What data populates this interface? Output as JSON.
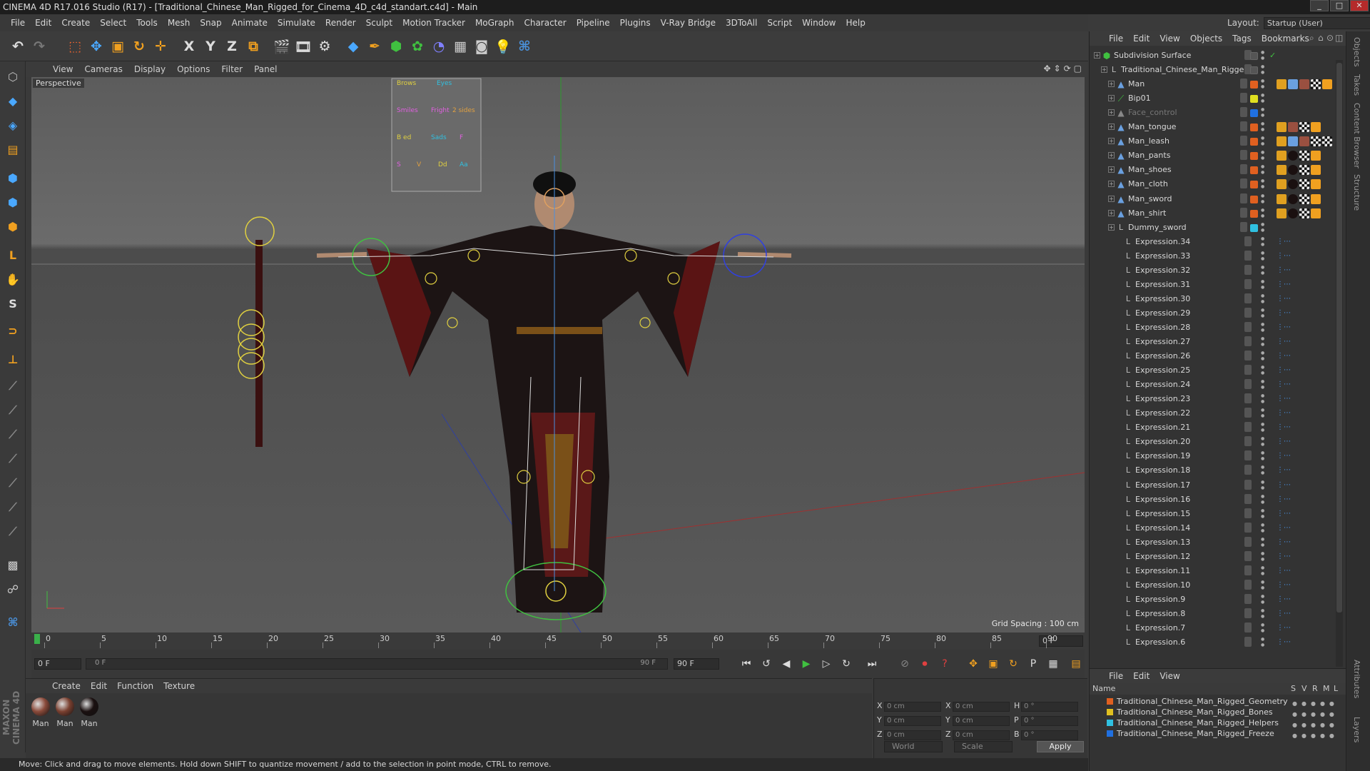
{
  "window": {
    "title": "CINEMA 4D R17.016 Studio (R17) - [Traditional_Chinese_Man_Rigged_for_Cinema_4D_c4d_standart.c4d] - Main",
    "controls": [
      "_",
      "□",
      "✕"
    ]
  },
  "menubar": {
    "items": [
      "File",
      "Edit",
      "Create",
      "Select",
      "Tools",
      "Mesh",
      "Snap",
      "Animate",
      "Simulate",
      "Render",
      "Sculpt",
      "Motion Tracker",
      "MoGraph",
      "Character",
      "Pipeline",
      "Plugins",
      "V-Ray Bridge",
      "3DToAll",
      "Script",
      "Window",
      "Help"
    ],
    "layout_label": "Layout:",
    "layout_value": "Startup (User)"
  },
  "toolbar": {
    "icons": [
      {
        "name": "undo-icon",
        "glyph": "↶",
        "color": "#dddddd"
      },
      {
        "name": "redo-icon",
        "glyph": "↷",
        "color": "#777777"
      },
      {
        "name": "live-selection-icon",
        "glyph": "⬚",
        "color": "#e06030"
      },
      {
        "name": "move-icon",
        "glyph": "✥",
        "color": "#4aa8ff"
      },
      {
        "name": "scale-icon",
        "glyph": "▣",
        "color": "#f0a020"
      },
      {
        "name": "rotate-icon",
        "glyph": "↻",
        "color": "#f0a020"
      },
      {
        "name": "transform-icon",
        "glyph": "✛",
        "color": "#f0a020"
      },
      {
        "name": "x-axis-icon",
        "glyph": "X",
        "color": "#dddddd"
      },
      {
        "name": "y-axis-icon",
        "glyph": "Y",
        "color": "#dddddd"
      },
      {
        "name": "z-axis-icon",
        "glyph": "Z",
        "color": "#dddddd"
      },
      {
        "name": "coordinate-system-icon",
        "glyph": "⧉",
        "color": "#f0a020"
      },
      {
        "name": "render-view-icon",
        "glyph": "🎬",
        "color": "#dddddd"
      },
      {
        "name": "render-picture-viewer-icon",
        "glyph": "🎞",
        "color": "#dddddd"
      },
      {
        "name": "render-settings-icon",
        "glyph": "⚙",
        "color": "#dddddd"
      },
      {
        "name": "cube-icon",
        "glyph": "◆",
        "color": "#4aa8ff"
      },
      {
        "name": "pen-icon",
        "glyph": "✒",
        "color": "#f0a020"
      },
      {
        "name": "subdivision-icon",
        "glyph": "⬢",
        "color": "#40c040"
      },
      {
        "name": "cloner-icon",
        "glyph": "✿",
        "color": "#40c040"
      },
      {
        "name": "deformer-icon",
        "glyph": "◔",
        "color": "#8080ff"
      },
      {
        "name": "floor-icon",
        "glyph": "▦",
        "color": "#cccccc"
      },
      {
        "name": "camera-icon",
        "glyph": "◙",
        "color": "#cccccc"
      },
      {
        "name": "light-icon",
        "glyph": "💡",
        "color": "#cccccc"
      },
      {
        "name": "python-icon",
        "glyph": "⌘",
        "color": "#4a90d9"
      }
    ]
  },
  "lefttools": [
    {
      "name": "make-editable-icon",
      "glyph": "⬡",
      "color": "#bbbbbb"
    },
    {
      "name": "model-mode-icon",
      "glyph": "◆",
      "color": "#4aa8ff"
    },
    {
      "name": "texture-mode-icon",
      "glyph": "◈",
      "color": "#4aa8ff"
    },
    {
      "name": "workplane-icon",
      "glyph": "▤",
      "color": "#f0a020"
    },
    {
      "name": "points-mode-icon",
      "glyph": "⬢",
      "color": "#4aa8ff"
    },
    {
      "name": "edges-mode-icon",
      "glyph": "⬢",
      "color": "#4aa8ff"
    },
    {
      "name": "polygons-mode-icon",
      "glyph": "⬢",
      "color": "#f0a020"
    },
    {
      "name": "axis-mode-icon",
      "glyph": "L",
      "color": "#f0a020"
    },
    {
      "name": "tweak-mode-icon",
      "glyph": "✋",
      "color": "#4aa8ff"
    },
    {
      "name": "snapping-icon",
      "glyph": "S",
      "color": "#dddddd"
    },
    {
      "name": "magnet-icon",
      "glyph": "⊃",
      "color": "#f0a020"
    },
    {
      "name": "joint-tool-icon",
      "glyph": "⊥",
      "color": "#f0a020"
    },
    {
      "name": "bone-tool-1-icon",
      "glyph": "⟋",
      "color": "#888888"
    },
    {
      "name": "bone-tool-2-icon",
      "glyph": "⟋",
      "color": "#888888"
    },
    {
      "name": "bone-tool-3-icon",
      "glyph": "⟋",
      "color": "#888888"
    },
    {
      "name": "bone-tool-4-icon",
      "glyph": "⟋",
      "color": "#888888"
    },
    {
      "name": "bone-tool-5-icon",
      "glyph": "⟋",
      "color": "#888888"
    },
    {
      "name": "bone-tool-6-icon",
      "glyph": "⟋",
      "color": "#888888"
    },
    {
      "name": "bone-tool-7-icon",
      "glyph": "⟋",
      "color": "#888888"
    },
    {
      "name": "checker-icon",
      "glyph": "▩",
      "color": "#cccccc"
    },
    {
      "name": "sculpt-icon",
      "glyph": "☍",
      "color": "#cccccc"
    },
    {
      "name": "python-script-icon",
      "glyph": "⌘",
      "color": "#4a90d9"
    }
  ],
  "viewport": {
    "menu": [
      "View",
      "Cameras",
      "Display",
      "Options",
      "Filter",
      "Panel"
    ],
    "label": "Perspective",
    "grid_spacing": "Grid Spacing : 100 cm",
    "face_control_labels": [
      "Brows",
      "Eyes",
      "Smiles",
      "Fright",
      "2 sides",
      "B ed",
      "Sads",
      "F",
      "S",
      "V",
      "Dd",
      "Aa"
    ]
  },
  "timeline": {
    "ticks": [
      "0",
      "5",
      "10",
      "15",
      "20",
      "25",
      "30",
      "35",
      "40",
      "45",
      "50",
      "55",
      "60",
      "65",
      "70",
      "75",
      "80",
      "85",
      "90"
    ],
    "current_frame": "0 F",
    "start_field": "0 F",
    "range_left": "0 F",
    "range_right": "90 F",
    "end_field": "90 F"
  },
  "playback": {
    "buttons": [
      {
        "name": "go-to-start-icon",
        "glyph": "⏮"
      },
      {
        "name": "prev-key-icon",
        "glyph": "⏪"
      },
      {
        "name": "prev-frame-icon",
        "glyph": "◀"
      },
      {
        "name": "play-icon",
        "glyph": "▶"
      },
      {
        "name": "next-frame-icon",
        "glyph": "▶"
      },
      {
        "name": "go-to-end-icon",
        "glyph": "⏭"
      }
    ]
  },
  "materials": {
    "menu": [
      "Create",
      "Edit",
      "Function",
      "Texture"
    ],
    "items": [
      {
        "label": "Man",
        "color": "#8a4a3a"
      },
      {
        "label": "Man",
        "color": "#7a4030"
      },
      {
        "label": "Man",
        "color": "#1a1010"
      }
    ]
  },
  "coordinates": {
    "rows": [
      {
        "a": "X",
        "av": "0 cm",
        "b": "X",
        "bv": "0 cm",
        "c": "H",
        "cv": "0 °"
      },
      {
        "a": "Y",
        "av": "0 cm",
        "b": "Y",
        "bv": "0 cm",
        "c": "P",
        "cv": "0 °"
      },
      {
        "a": "Z",
        "av": "0 cm",
        "b": "Z",
        "bv": "0 cm",
        "c": "B",
        "cv": "0 °"
      }
    ],
    "world": "World",
    "scale": "Scale",
    "apply": "Apply"
  },
  "status": "Move: Click and drag to move elements. Hold down SHIFT to quantize movement / add to the selection in point mode, CTRL to remove.",
  "objects": {
    "menu": [
      "File",
      "Edit",
      "View",
      "Objects",
      "Tags",
      "Bookmarks"
    ],
    "rows": [
      {
        "name": "Subdivision Surface",
        "indent": 0,
        "icon": "⬢",
        "icolor": "#40c040",
        "c1": "",
        "tags": []
      },
      {
        "name": "Traditional_Chinese_Man_Rigged",
        "indent": 1,
        "icon": "L0",
        "icolor": "#bbbbbb",
        "c1": "",
        "tags": []
      },
      {
        "name": "Man",
        "indent": 2,
        "icon": "▲",
        "icolor": "#6aa0e0",
        "c1": "#e06020",
        "tags": [
          "#e0a020",
          "#6aa0e0",
          "#9a5040",
          "#eeeeee",
          "#f0a020"
        ]
      },
      {
        "name": "Bip01",
        "indent": 2,
        "icon": "⟋",
        "icolor": "#40c040",
        "c1": "#e0e020",
        "tags": []
      },
      {
        "name": "Face_control",
        "indent": 2,
        "icon": "▲",
        "icolor": "#888888",
        "c1": "#2070e0",
        "tags": [],
        "dim": true
      },
      {
        "name": "Man_tongue",
        "indent": 2,
        "icon": "▲",
        "icolor": "#6aa0e0",
        "c1": "#e06020",
        "tags": [
          "#e0a020",
          "#9a5040",
          "#eeeeee",
          "#f0a020"
        ]
      },
      {
        "name": "Man_leash",
        "indent": 2,
        "icon": "▲",
        "icolor": "#6aa0e0",
        "c1": "#e06020",
        "tags": [
          "#e0a020",
          "#6aa0e0",
          "#9a5040",
          "#eeeeee",
          "#eeeeee"
        ]
      },
      {
        "name": "Man_pants",
        "indent": 2,
        "icon": "▲",
        "icolor": "#6aa0e0",
        "c1": "#e06020",
        "tags": [
          "#e0a020",
          "#1a1010",
          "#eeeeee",
          "#f0a020"
        ]
      },
      {
        "name": "Man_shoes",
        "indent": 2,
        "icon": "▲",
        "icolor": "#6aa0e0",
        "c1": "#e06020",
        "tags": [
          "#e0a020",
          "#1a1010",
          "#eeeeee",
          "#f0a020"
        ]
      },
      {
        "name": "Man_cloth",
        "indent": 2,
        "icon": "▲",
        "icolor": "#6aa0e0",
        "c1": "#e06020",
        "tags": [
          "#e0a020",
          "#1a1010",
          "#eeeeee",
          "#f0a020"
        ]
      },
      {
        "name": "Man_sword",
        "indent": 2,
        "icon": "▲",
        "icolor": "#6aa0e0",
        "c1": "#e06020",
        "tags": [
          "#e0a020",
          "#1a1010",
          "#eeeeee",
          "#f0a020"
        ]
      },
      {
        "name": "Man_shirt",
        "indent": 2,
        "icon": "▲",
        "icolor": "#6aa0e0",
        "c1": "#e06020",
        "tags": [
          "#e0a020",
          "#1a1010",
          "#eeeeee",
          "#f0a020"
        ]
      },
      {
        "name": "Dummy_sword",
        "indent": 2,
        "icon": "L0",
        "icolor": "#bbbbbb",
        "c1": "#30c0e0",
        "tags": []
      },
      {
        "name": "Expression.34",
        "indent": 3,
        "icon": "L0",
        "icolor": "#bbbbbb",
        "c1": "",
        "tags": [],
        "expr": true
      },
      {
        "name": "Expression.33",
        "indent": 3,
        "icon": "L0",
        "icolor": "#bbbbbb",
        "c1": "",
        "tags": [],
        "expr": true
      },
      {
        "name": "Expression.32",
        "indent": 3,
        "icon": "L0",
        "icolor": "#bbbbbb",
        "c1": "",
        "tags": [],
        "expr": true
      },
      {
        "name": "Expression.31",
        "indent": 3,
        "icon": "L0",
        "icolor": "#bbbbbb",
        "c1": "",
        "tags": [],
        "expr": true
      },
      {
        "name": "Expression.30",
        "indent": 3,
        "icon": "L0",
        "icolor": "#bbbbbb",
        "c1": "",
        "tags": [],
        "expr": true
      },
      {
        "name": "Expression.29",
        "indent": 3,
        "icon": "L0",
        "icolor": "#bbbbbb",
        "c1": "",
        "tags": [],
        "expr": true
      },
      {
        "name": "Expression.28",
        "indent": 3,
        "icon": "L0",
        "icolor": "#bbbbbb",
        "c1": "",
        "tags": [],
        "expr": true
      },
      {
        "name": "Expression.27",
        "indent": 3,
        "icon": "L0",
        "icolor": "#bbbbbb",
        "c1": "",
        "tags": [],
        "expr": true
      },
      {
        "name": "Expression.26",
        "indent": 3,
        "icon": "L0",
        "icolor": "#bbbbbb",
        "c1": "",
        "tags": [],
        "expr": true
      },
      {
        "name": "Expression.25",
        "indent": 3,
        "icon": "L0",
        "icolor": "#bbbbbb",
        "c1": "",
        "tags": [],
        "expr": true
      },
      {
        "name": "Expression.24",
        "indent": 3,
        "icon": "L0",
        "icolor": "#bbbbbb",
        "c1": "",
        "tags": [],
        "expr": true
      },
      {
        "name": "Expression.23",
        "indent": 3,
        "icon": "L0",
        "icolor": "#bbbbbb",
        "c1": "",
        "tags": [],
        "expr": true
      },
      {
        "name": "Expression.22",
        "indent": 3,
        "icon": "L0",
        "icolor": "#bbbbbb",
        "c1": "",
        "tags": [],
        "expr": true
      },
      {
        "name": "Expression.21",
        "indent": 3,
        "icon": "L0",
        "icolor": "#bbbbbb",
        "c1": "",
        "tags": [],
        "expr": true
      },
      {
        "name": "Expression.20",
        "indent": 3,
        "icon": "L0",
        "icolor": "#bbbbbb",
        "c1": "",
        "tags": [],
        "expr": true
      },
      {
        "name": "Expression.19",
        "indent": 3,
        "icon": "L0",
        "icolor": "#bbbbbb",
        "c1": "",
        "tags": [],
        "expr": true
      },
      {
        "name": "Expression.18",
        "indent": 3,
        "icon": "L0",
        "icolor": "#bbbbbb",
        "c1": "",
        "tags": [],
        "expr": true
      },
      {
        "name": "Expression.17",
        "indent": 3,
        "icon": "L0",
        "icolor": "#bbbbbb",
        "c1": "",
        "tags": [],
        "expr": true
      },
      {
        "name": "Expression.16",
        "indent": 3,
        "icon": "L0",
        "icolor": "#bbbbbb",
        "c1": "",
        "tags": [],
        "expr": true
      },
      {
        "name": "Expression.15",
        "indent": 3,
        "icon": "L0",
        "icolor": "#bbbbbb",
        "c1": "",
        "tags": [],
        "expr": true
      },
      {
        "name": "Expression.14",
        "indent": 3,
        "icon": "L0",
        "icolor": "#bbbbbb",
        "c1": "",
        "tags": [],
        "expr": true
      },
      {
        "name": "Expression.13",
        "indent": 3,
        "icon": "L0",
        "icolor": "#bbbbbb",
        "c1": "",
        "tags": [],
        "expr": true
      },
      {
        "name": "Expression.12",
        "indent": 3,
        "icon": "L0",
        "icolor": "#bbbbbb",
        "c1": "",
        "tags": [],
        "expr": true
      },
      {
        "name": "Expression.11",
        "indent": 3,
        "icon": "L0",
        "icolor": "#bbbbbb",
        "c1": "",
        "tags": [],
        "expr": true
      },
      {
        "name": "Expression.10",
        "indent": 3,
        "icon": "L0",
        "icolor": "#bbbbbb",
        "c1": "",
        "tags": [],
        "expr": true
      },
      {
        "name": "Expression.9",
        "indent": 3,
        "icon": "L0",
        "icolor": "#bbbbbb",
        "c1": "",
        "tags": [],
        "expr": true
      },
      {
        "name": "Expression.8",
        "indent": 3,
        "icon": "L0",
        "icolor": "#bbbbbb",
        "c1": "",
        "tags": [],
        "expr": true
      },
      {
        "name": "Expression.7",
        "indent": 3,
        "icon": "L0",
        "icolor": "#bbbbbb",
        "c1": "",
        "tags": [],
        "expr": true
      },
      {
        "name": "Expression.6",
        "indent": 3,
        "icon": "L0",
        "icolor": "#bbbbbb",
        "c1": "",
        "tags": [],
        "expr": true
      }
    ]
  },
  "layers": {
    "menu": [
      "File",
      "Edit",
      "View"
    ],
    "header": {
      "name": "Name",
      "flags": [
        "S",
        "V",
        "R",
        "M",
        "L"
      ]
    },
    "rows": [
      {
        "name": "Traditional_Chinese_Man_Rigged_Geometry",
        "color": "#e06020"
      },
      {
        "name": "Traditional_Chinese_Man_Rigged_Bones",
        "color": "#e0c020"
      },
      {
        "name": "Traditional_Chinese_Man_Rigged_Helpers",
        "color": "#30c0e0"
      },
      {
        "name": "Traditional_Chinese_Man_Rigged_Freeze",
        "color": "#2070e0"
      }
    ]
  },
  "side_tabs": [
    "Objects",
    "Takes",
    "Content Browser",
    "Structure",
    "Attributes",
    "Layers"
  ]
}
